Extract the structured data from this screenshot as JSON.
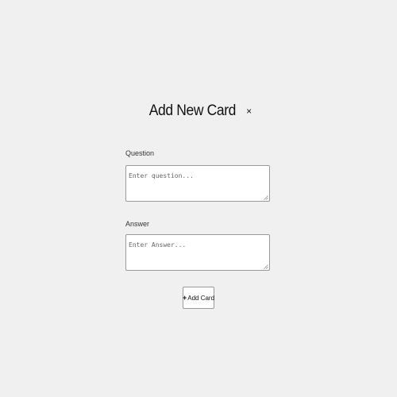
{
  "modal": {
    "title": "Add New Card",
    "close_glyph": "×"
  },
  "form": {
    "question": {
      "label": "Question",
      "placeholder": "Enter question...",
      "value": ""
    },
    "answer": {
      "label": "Answer",
      "placeholder": "Enter Answer...",
      "value": ""
    },
    "submit": {
      "icon": "plus-icon",
      "icon_glyph": "+",
      "label": "Add Card"
    }
  },
  "colors": {
    "background": "#f0f0f0",
    "input_background": "#ffffff",
    "border": "#9a9a9a"
  }
}
